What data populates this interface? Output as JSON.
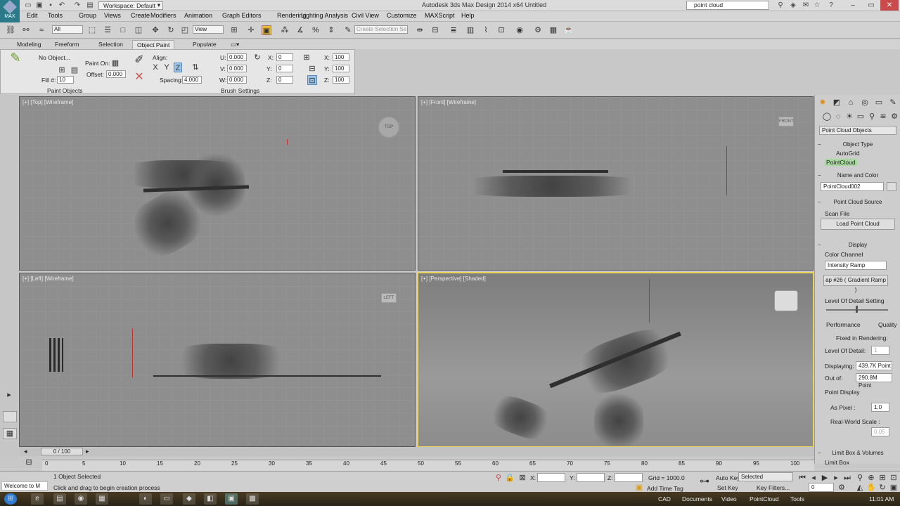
{
  "app": {
    "title": "Autodesk 3ds Max Design 2014 x64    Untitled",
    "workspace": "Workspace: Default",
    "search": "point cloud",
    "logo_text": "MAX"
  },
  "menu": [
    "Edit",
    "Tools",
    "Group",
    "Views",
    "Create",
    "Modifiers",
    "Animation",
    "Graph Editors",
    "Rendering",
    "Lighting Analysis",
    "Civil View",
    "Customize",
    "MAXScript",
    "Help"
  ],
  "toolbar": {
    "selection_filter": "All",
    "ref_coord": "View",
    "named_sel": "Create Selection Se"
  },
  "ribbon_tabs": [
    "Modeling",
    "Freeform",
    "Selection",
    "Object Paint",
    "Populate"
  ],
  "ribbon": {
    "no_object": "No Object...",
    "fill_label": "Fill #:",
    "fill_value": "10",
    "paint_on": "Paint On:",
    "offset_label": "Offset:",
    "offset_value": "0.000",
    "align_label": "Align:",
    "x": "X",
    "y": "Y",
    "z": "Z",
    "spacing_label": "Spacing:",
    "spacing_value": "4.000",
    "u_label": "U:",
    "u_value": "0.000",
    "v_label": "V:",
    "v_value": "0.000",
    "w_label": "W:",
    "w_value": "0.000",
    "rx_label": "X:",
    "rx_value": "0",
    "ry_label": "Y:",
    "ry_value": "0",
    "rz_label": "Z:",
    "rz_value": "0",
    "sx_label": "X:",
    "sx_value": "100",
    "sy_label": "Y:",
    "sy_value": "100",
    "sz_label": "Z:",
    "sz_value": "100",
    "group_paint_objects": "Paint Objects",
    "group_brush_settings": "Brush Settings"
  },
  "viewports": {
    "top": "[+] [Top] [Wireframe]",
    "front": "[+] [Front] [Wireframe]",
    "left": "[+] [Left] [Wireframe]",
    "perspective": "[+] [Perspective] [Shaded]",
    "cube_top": "TOP",
    "cube_front": "FRONT",
    "cube_left": "LEFT"
  },
  "command_panel": {
    "category": "Point Cloud Objects",
    "object_type": "Object Type",
    "autogrid": "AutoGrid",
    "pointcloud_btn": "PointCloud",
    "name_and_color": "Name and Color",
    "name_value": "PointCloud002",
    "source": "Point Cloud Source",
    "scan_file": "Scan File",
    "load_btn": "Load Point Cloud",
    "display": "Display",
    "color_channel": "Color Channel",
    "color_channel_value": "Intensity Ramp",
    "gradient": "ap #26  ( Gradient Ramp )",
    "lod_setting": "Level Of Detail Setting",
    "performance": "Performance",
    "quality": "Quality",
    "fixed_rendering": "Fixed in Rendering:",
    "lod_label": "Level Of Detail:",
    "lod_value": "1",
    "displaying_label": "Displaying:",
    "displaying_value": "439.7K Point",
    "outof_label": "Out of:",
    "outof_value": "290.8M Point",
    "point_display": "Point Display",
    "as_pixel": "As Pixel :",
    "as_pixel_value": "1.0",
    "real_world": "Real-World Scale :",
    "real_world_value": "0.05",
    "limit_box_volumes": "Limit Box & Volumes",
    "limit_box": "Limit Box"
  },
  "timeline": {
    "frame": "0 / 100",
    "ticks": [
      "0",
      "5",
      "10",
      "15",
      "20",
      "25",
      "30",
      "35",
      "40",
      "45",
      "50",
      "55",
      "60",
      "65",
      "70",
      "75",
      "80",
      "85",
      "90",
      "95",
      "100"
    ]
  },
  "status": {
    "selected": "1 Object Selected",
    "prompt": "Click and drag to begin creation process",
    "welcome": "Welcome to M",
    "x_label": "X:",
    "y_label": "Y:",
    "z_label": "Z:",
    "grid": "Grid = 1000.0",
    "add_time_tag": "Add Time Tag",
    "auto_key": "Auto Key",
    "set_key": "Set Key",
    "key_mode": "Selected",
    "key_filters": "Key Filters...",
    "frame_field": "0"
  },
  "taskbar": {
    "cad": "CAD",
    "documents": "Documents",
    "video": "Video",
    "pointcloud": "PointCloud",
    "tools": "Tools",
    "time": "11:01 AM"
  }
}
